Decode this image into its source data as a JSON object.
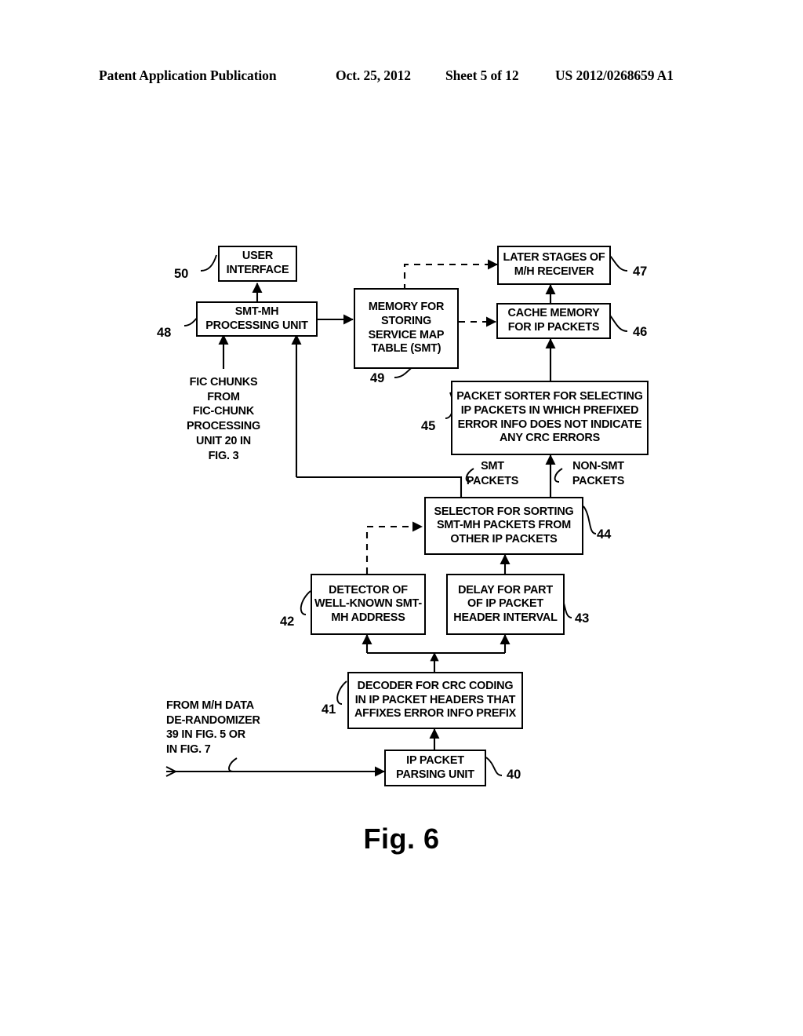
{
  "header": {
    "publication": "Patent Application Publication",
    "date": "Oct. 25, 2012",
    "sheet": "Sheet 5 of 12",
    "patent_number": "US 2012/0268659 A1"
  },
  "figure": {
    "caption": "Fig. 6"
  },
  "blocks": {
    "user_interface": {
      "label": "USER\nINTERFACE",
      "ref": "50"
    },
    "smt_mh_processing_unit": {
      "label": "SMT-MH\nPROCESSING UNIT",
      "ref": "48"
    },
    "memory_smt": {
      "label": "MEMORY FOR\nSTORING\nSERVICE MAP\nTABLE (SMT)",
      "ref": "49"
    },
    "later_stages": {
      "label": "LATER STAGES\nOF M/H RECEIVER",
      "ref": "47"
    },
    "cache_memory": {
      "label": "CACHE  MEMORY\nFOR IP PACKETS",
      "ref": "46"
    },
    "packet_sorter": {
      "label": "PACKET SORTER FOR SELECTING\nIP PACKETS IN WHICH PREFIXED\nERROR INFO DOES NOT INDICATE\nANY CRC ERRORS",
      "ref": "45"
    },
    "selector": {
      "label": "SELECTOR FOR SORTING\nSMT-MH PACKETS FROM\nOTHER IP PACKETS",
      "ref": "44"
    },
    "detector": {
      "label": "DETECTOR OF\nWELL-KNOWN\nSMT-MH ADDRESS",
      "ref": "42"
    },
    "delay": {
      "label": "DELAY FOR PART\nOF IP PACKET\nHEADER INTERVAL",
      "ref": "43"
    },
    "decoder": {
      "label": "DECODER FOR CRC CODING\nIN IP PACKET HEADERS THAT\nAFFIXES ERROR INFO PREFIX",
      "ref": "41"
    },
    "ip_packet_parsing_unit": {
      "label": "IP PACKET\nPARSING UNIT",
      "ref": "40"
    }
  },
  "annotations": {
    "fic_chunks_source": "FIC CHUNKS\nFROM\nFIC-CHUNK\nPROCESSING\nUNIT 20 IN\nFIG. 3",
    "smt_packets": "SMT\nPACKETS",
    "non_smt_packets": "NON-SMT\nPACKETS",
    "derandomizer_source": "FROM M/H DATA\nDE-RANDOMIZER\n39 IN FIG. 5 OR\nIN FIG. 7"
  },
  "colors": {
    "ink": "#000000",
    "paper": "#ffffff"
  }
}
